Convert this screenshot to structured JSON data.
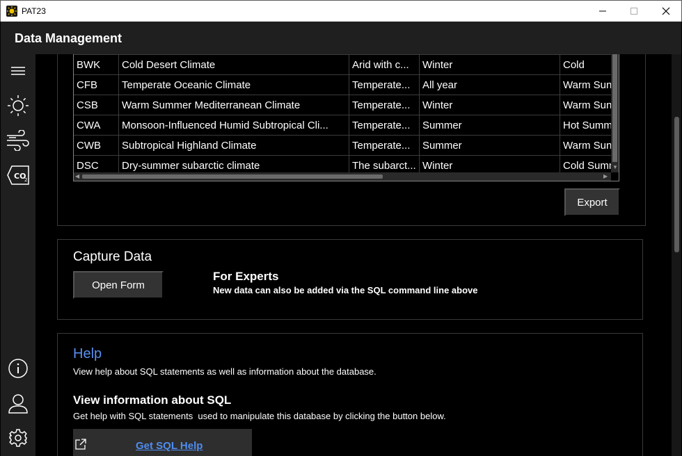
{
  "window": {
    "title": "PAT23",
    "icon": "sun-logo-icon",
    "controls": [
      "minimize-icon",
      "maximize-icon",
      "close-icon"
    ]
  },
  "header": {
    "title": "Data Management"
  },
  "sidebar": {
    "items": [
      {
        "icon": "hamburger-menu-icon"
      },
      {
        "icon": "sun-icon"
      },
      {
        "icon": "wind-icon"
      },
      {
        "icon": "co2-icon"
      },
      {
        "icon": "info-icon"
      },
      {
        "icon": "user-icon"
      },
      {
        "icon": "gear-icon"
      }
    ]
  },
  "table": {
    "rows": [
      [
        "BWK",
        "Cold Desert Climate",
        "Arid with c...",
        "Winter",
        "Cold"
      ],
      [
        "CFB",
        "Temperate Oceanic Climate",
        "Temperate...",
        "All year",
        "Warm Sun"
      ],
      [
        "CSB",
        "Warm Summer Mediterranean Climate",
        "Temperate...",
        "Winter",
        "Warm Sun"
      ],
      [
        "CWA",
        "Monsoon-Influenced Humid Subtropical Cli...",
        "Temperate...",
        "Summer",
        "Hot Summ"
      ],
      [
        "CWB",
        "Subtropical Highland Climate",
        "Temperate...",
        "Summer",
        "Warm Sun"
      ],
      [
        "DSC",
        "Dry-summer subarctic climate",
        "The subarct...",
        "Winter",
        "Cold Summ"
      ]
    ],
    "export_label": "Export"
  },
  "capture": {
    "title": "Capture Data",
    "open_form_label": "Open Form",
    "experts_title": "For Experts",
    "experts_text": "New data can also be added via the SQL command line above"
  },
  "help": {
    "title": "Help",
    "text": "View help about SQL statements as well as information about the database.",
    "sql_title": "View information about SQL",
    "sql_text": "Get help with SQL statements  used to manipulate this database by clicking the button below.",
    "sql_button_label": "Get SQL Help",
    "sql_button_icon": "external-link-icon"
  },
  "colors": {
    "background": "#000000",
    "panel_bar": "#1f1f1f",
    "button": "#333333",
    "accent_link": "#4f8df0"
  }
}
